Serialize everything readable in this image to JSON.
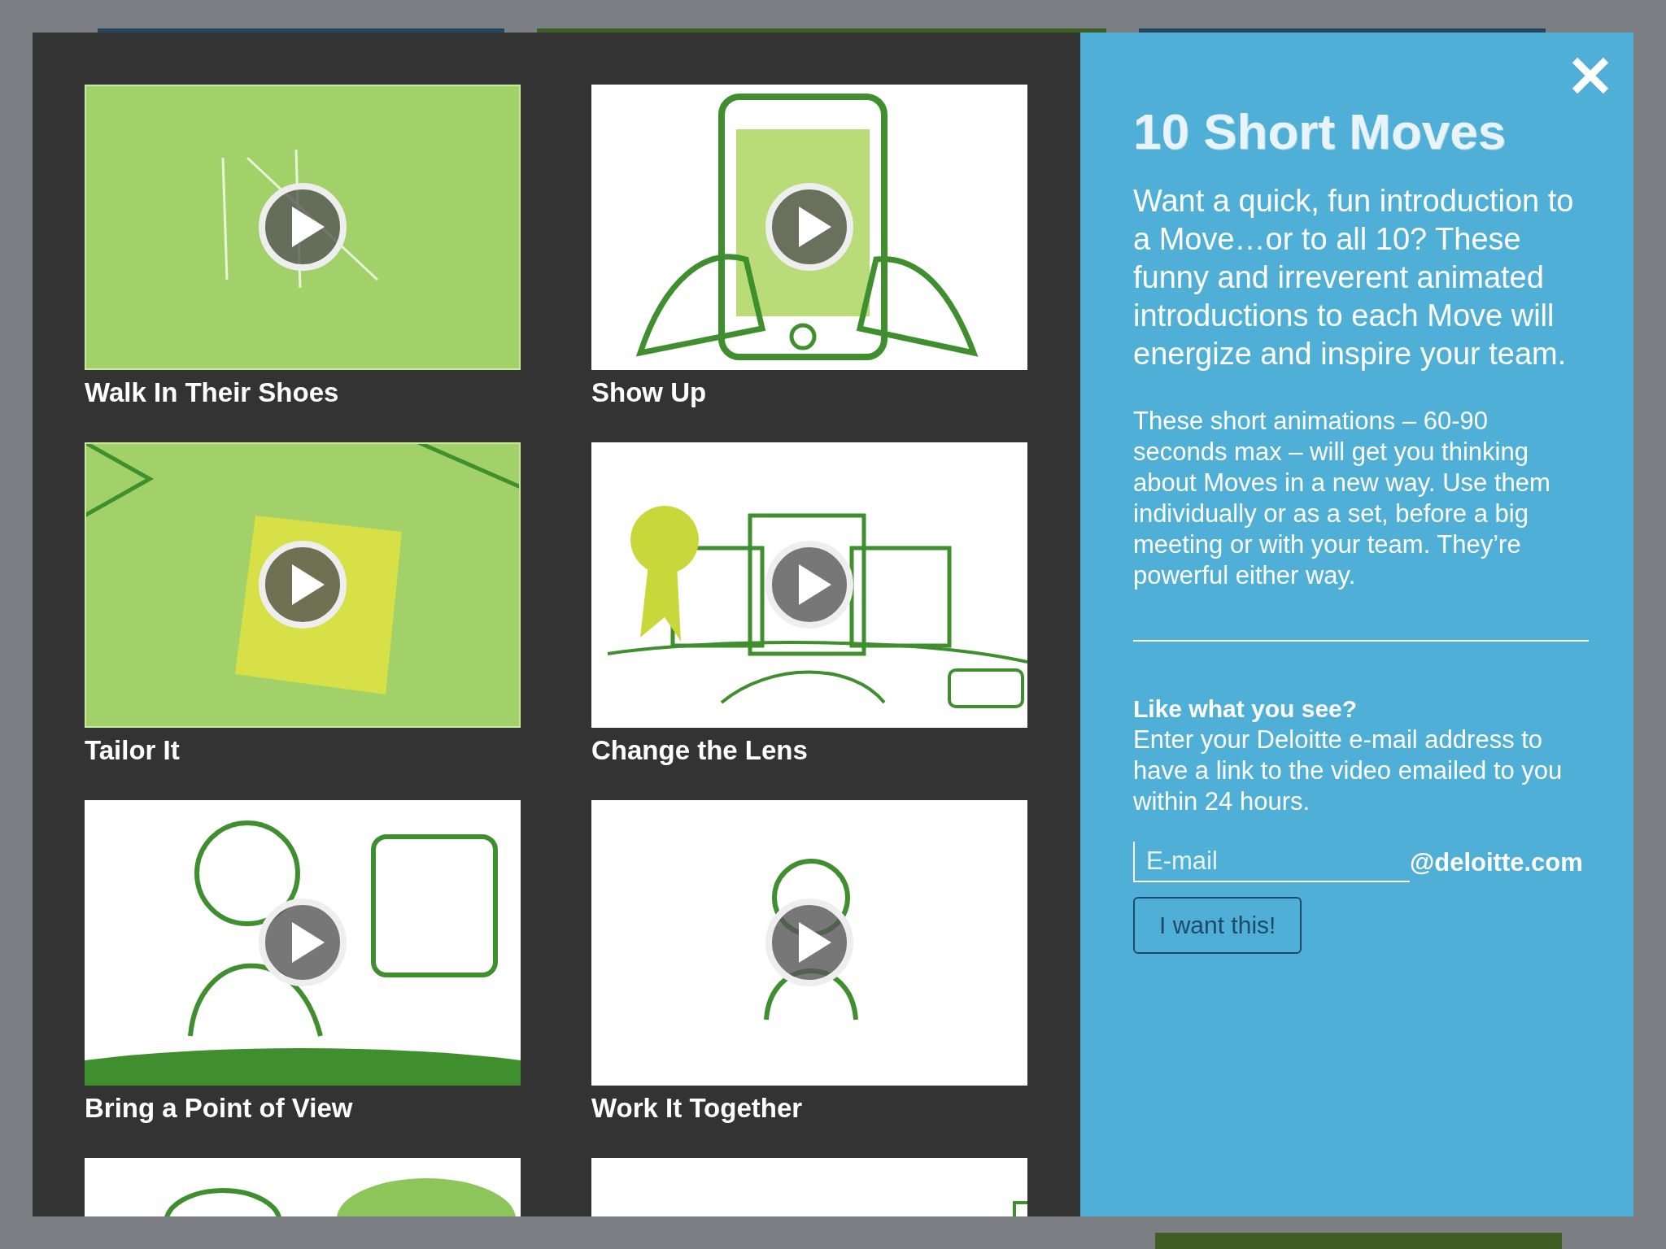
{
  "videos": [
    {
      "kind": "video",
      "title": "Walk In Their Shoes"
    },
    {
      "kind": "video",
      "title": "Show Up"
    },
    {
      "kind": "video",
      "title": "Tailor It"
    },
    {
      "kind": "video",
      "title": "Change the Lens"
    },
    {
      "kind": "video",
      "title": "Bring a Point of View"
    },
    {
      "kind": "video",
      "title": "Work It Together"
    },
    {
      "kind": "picture"
    },
    {
      "kind": "picture"
    }
  ],
  "panel": {
    "title": "10 Short Moves",
    "intro": "Want a quick, fun introduction to a Move…or to all 10? These funny and irreverent animated introductions to each Move will energize and inspire your team.",
    "details": "These short animations – 60-90 seconds max – will get you thinking about Moves in a new way. Use them individually or as a set, before a big meeting or with your team. They’re powerful either way.",
    "signup_heading": "Like what you see?",
    "signup_text": "Enter your Deloitte e-mail address to have a link to the video emailed to you within 24 hours.",
    "email": {
      "placeholder": "E-mail",
      "suffix": "@deloitte.com"
    },
    "button": "I want this!"
  }
}
